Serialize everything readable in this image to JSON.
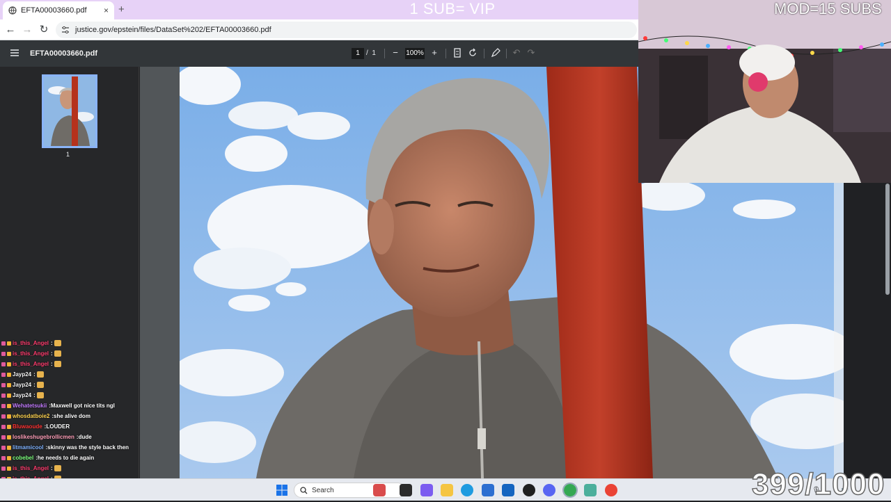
{
  "browser": {
    "tab_title": "EFTA00003660.pdf",
    "tab_close": "×",
    "new_tab": "+",
    "url": "justice.gov/epstein/files/DataSet%202/EFTA00003660.pdf"
  },
  "overlay": {
    "vip_text": "1 SUB= VIP",
    "mod_text": "MOD=15 SUBS",
    "sub_counter": "399/1000"
  },
  "pdf": {
    "title": "EFTA00003660.pdf",
    "current_page": "1",
    "page_separator": "/",
    "total_pages": "1",
    "zoom": "100%",
    "zoom_out": "−",
    "zoom_in": "+",
    "thumbnail_label": "1"
  },
  "chat": {
    "messages": [
      {
        "user": "is_this_Angel",
        "color": "#ff3c6e",
        "text": "",
        "emote": true
      },
      {
        "user": "is_this_Angel",
        "color": "#ff3c6e",
        "text": "",
        "emote": true
      },
      {
        "user": "is_this_Angel",
        "color": "#ff3c6e",
        "text": "",
        "emote": true
      },
      {
        "user": "Jayp24",
        "color": "#f5f5f5",
        "text": "",
        "emote": true
      },
      {
        "user": "Jayp24",
        "color": "#f5f5f5",
        "text": "",
        "emote": true
      },
      {
        "user": "Jayp24",
        "color": "#f5f5f5",
        "text": "",
        "emote": true
      },
      {
        "user": "Wehatetsukii",
        "color": "#c37bff",
        "text": "Maxwell got nice tits ngl",
        "emote": false
      },
      {
        "user": "whosdatboie2",
        "color": "#ffd34f",
        "text": "she alive dom",
        "emote": false
      },
      {
        "user": "Bluwaoude",
        "color": "#ff3333",
        "text": "LOUDER",
        "emote": false
      },
      {
        "user": "loslikeshugebrollicmen",
        "color": "#ff9eb8",
        "text": "dude",
        "emote": false
      },
      {
        "user": "litmamicool",
        "color": "#7fb2ff",
        "text": "skinny was the style back then",
        "emote": false
      },
      {
        "user": "cobebel",
        "color": "#7dff7d",
        "text": "he needs to die again",
        "emote": false
      },
      {
        "user": "is_this_Angel",
        "color": "#ff3c6e",
        "text": "",
        "emote": true
      },
      {
        "user": "is_this_Angel",
        "color": "#ff3c6e",
        "text": "",
        "emote": true
      }
    ]
  },
  "taskbar": {
    "search_placeholder": "Search"
  },
  "colors": {
    "tab_strip": "#e7d2f7",
    "pdf_toolbar": "#323639",
    "accent": "#8ab4f8"
  }
}
